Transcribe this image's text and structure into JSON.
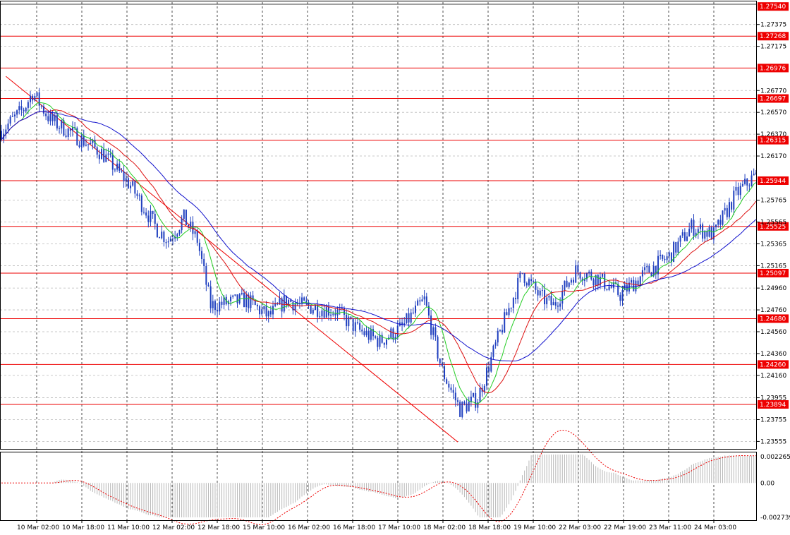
{
  "chart_data": [
    {
      "type": "candlestick",
      "title": "",
      "ylim": [
        1.2348,
        1.2758
      ],
      "x_axis_labels": [
        "10 Mar 02:00",
        "10 Mar 18:00",
        "11 Mar 10:00",
        "12 Mar 02:00",
        "12 Mar 18:00",
        "15 Mar 10:00",
        "16 Mar 02:00",
        "16 Mar 18:00",
        "17 Mar 10:00",
        "18 Mar 02:00",
        "18 Mar 18:00",
        "19 Mar 10:00",
        "22 Mar 03:00",
        "22 Mar 19:00",
        "23 Mar 11:00",
        "24 Mar 03:00"
      ],
      "y_ticks": [
        "1.27375",
        "1.27175",
        "1.26770",
        "1.26570",
        "1.26370",
        "1.26170",
        "1.25765",
        "1.25565",
        "1.25365",
        "1.25165",
        "1.24960",
        "1.24760",
        "1.24560",
        "1.24360",
        "1.24160",
        "1.23955",
        "1.23755",
        "1.23555"
      ],
      "current_price": "1.27540",
      "colors": {
        "candles": "#1f3fbf",
        "ma_fast": "#22cc22",
        "ma_mid": "#dd1111",
        "ma_slow": "#1111cc",
        "levels": "#ee0000",
        "trendline": "#ee0000"
      },
      "horizontal_levels": [
        {
          "value": 1.27268,
          "label": "1.27268"
        },
        {
          "value": 1.26976,
          "label": "1.26976"
        },
        {
          "value": 1.26697,
          "label": "1.26697"
        },
        {
          "value": 1.26315,
          "label": "1.26315"
        },
        {
          "value": 1.25944,
          "label": "1.25944"
        },
        {
          "value": 1.25525,
          "label": "1.25525"
        },
        {
          "value": 1.25097,
          "label": "1.25097"
        },
        {
          "value": 1.2468,
          "label": "1.24680"
        },
        {
          "value": 1.2426,
          "label": "1.24260"
        },
        {
          "value": 1.23894,
          "label": "1.23894"
        }
      ],
      "trendline": {
        "start": {
          "bar": 2,
          "value": 1.269
        },
        "end": {
          "bar": 205,
          "value": 1.2355
        }
      },
      "price_path": [
        [
          0,
          1.264
        ],
        [
          10,
          1.266
        ],
        [
          14,
          1.2675
        ],
        [
          22,
          1.265
        ],
        [
          30,
          1.264
        ],
        [
          45,
          1.262
        ],
        [
          58,
          1.259
        ],
        [
          70,
          1.255
        ],
        [
          75,
          1.254
        ],
        [
          82,
          1.256
        ],
        [
          88,
          1.254
        ],
        [
          94,
          1.248
        ],
        [
          110,
          1.2485
        ],
        [
          120,
          1.247
        ],
        [
          128,
          1.2485
        ],
        [
          135,
          1.248
        ],
        [
          150,
          1.2475
        ],
        [
          160,
          1.2458
        ],
        [
          170,
          1.2447
        ],
        [
          180,
          1.246
        ],
        [
          190,
          1.2485
        ],
        [
          198,
          1.242
        ],
        [
          206,
          1.2385
        ],
        [
          214,
          1.2395
        ],
        [
          224,
          1.2455
        ],
        [
          234,
          1.251
        ],
        [
          242,
          1.2488
        ],
        [
          248,
          1.248
        ],
        [
          258,
          1.2512
        ],
        [
          268,
          1.2505
        ],
        [
          278,
          1.249
        ],
        [
          288,
          1.2508
        ],
        [
          300,
          1.2525
        ],
        [
          310,
          1.2552
        ],
        [
          320,
          1.2545
        ],
        [
          330,
          1.2582
        ],
        [
          338,
          1.2598
        ]
      ],
      "ma_periods": {
        "fast": 5,
        "mid": 11,
        "slow": 21
      },
      "candle_count": 340
    },
    {
      "type": "histogram",
      "name": "oscillator",
      "ylim": [
        -0.002739,
        0.002265
      ],
      "y_ticks": [
        "0.002265",
        "0.00",
        "-0.002739"
      ],
      "colors": {
        "bars": "#b8b8b8",
        "signal": "#ee0000"
      }
    }
  ]
}
